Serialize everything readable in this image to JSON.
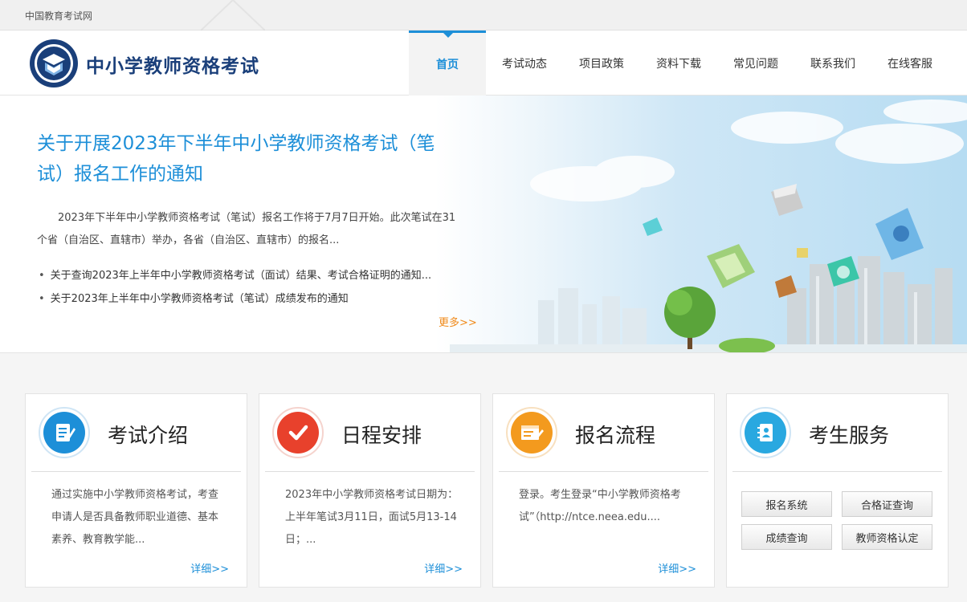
{
  "topbar": {
    "site_link": "中国教育考试网"
  },
  "header": {
    "title": "中小学教师资格考试",
    "nav": [
      "首页",
      "考试动态",
      "项目政策",
      "资料下载",
      "常见问题",
      "联系我们",
      "在线客服"
    ],
    "active_index": 0
  },
  "banner": {
    "headline": "关于开展2023年下半年中小学教师资格考试（笔试）报名工作的通知",
    "summary": "2023年下半年中小学教师资格考试（笔试）报名工作将于7月7日开始。此次笔试在31个省（自治区、直辖市）举办，各省（自治区、直辖市）的报名...",
    "news": [
      "关于查询2023年上半年中小学教师资格考试（面试）结果、考试合格证明的通知...",
      "关于2023年上半年中小学教师资格考试（笔试）成绩发布的通知"
    ],
    "more": "更多>>"
  },
  "cards": [
    {
      "title": "考试介绍",
      "icon": "document-edit-icon",
      "text": "通过实施中小学教师资格考试，考查申请人是否具备教师职业道德、基本素养、教育教学能...",
      "detail": "详细>>"
    },
    {
      "title": "日程安排",
      "icon": "checkmark-icon",
      "text": "2023年中小学教师资格考试日期为：上半年笔试3月11日，面试5月13-14日；...",
      "detail": "详细>>"
    },
    {
      "title": "报名流程",
      "icon": "form-pen-icon",
      "text": "登录。考生登录“中小学教师资格考试”（http://ntce.neea.edu....",
      "detail": "详细>>"
    },
    {
      "title": "考生服务",
      "icon": "contact-book-icon",
      "buttons": [
        "报名系统",
        "合格证查询",
        "成绩查询",
        "教师资格认定"
      ]
    }
  ],
  "colors": {
    "accent": "#1d8fd8",
    "brand": "#1a3f7a",
    "more": "#f08a1a",
    "card1": "#1d8fd8",
    "card2": "#e8412c",
    "card3": "#f39a1e",
    "card4": "#29a8e0"
  }
}
